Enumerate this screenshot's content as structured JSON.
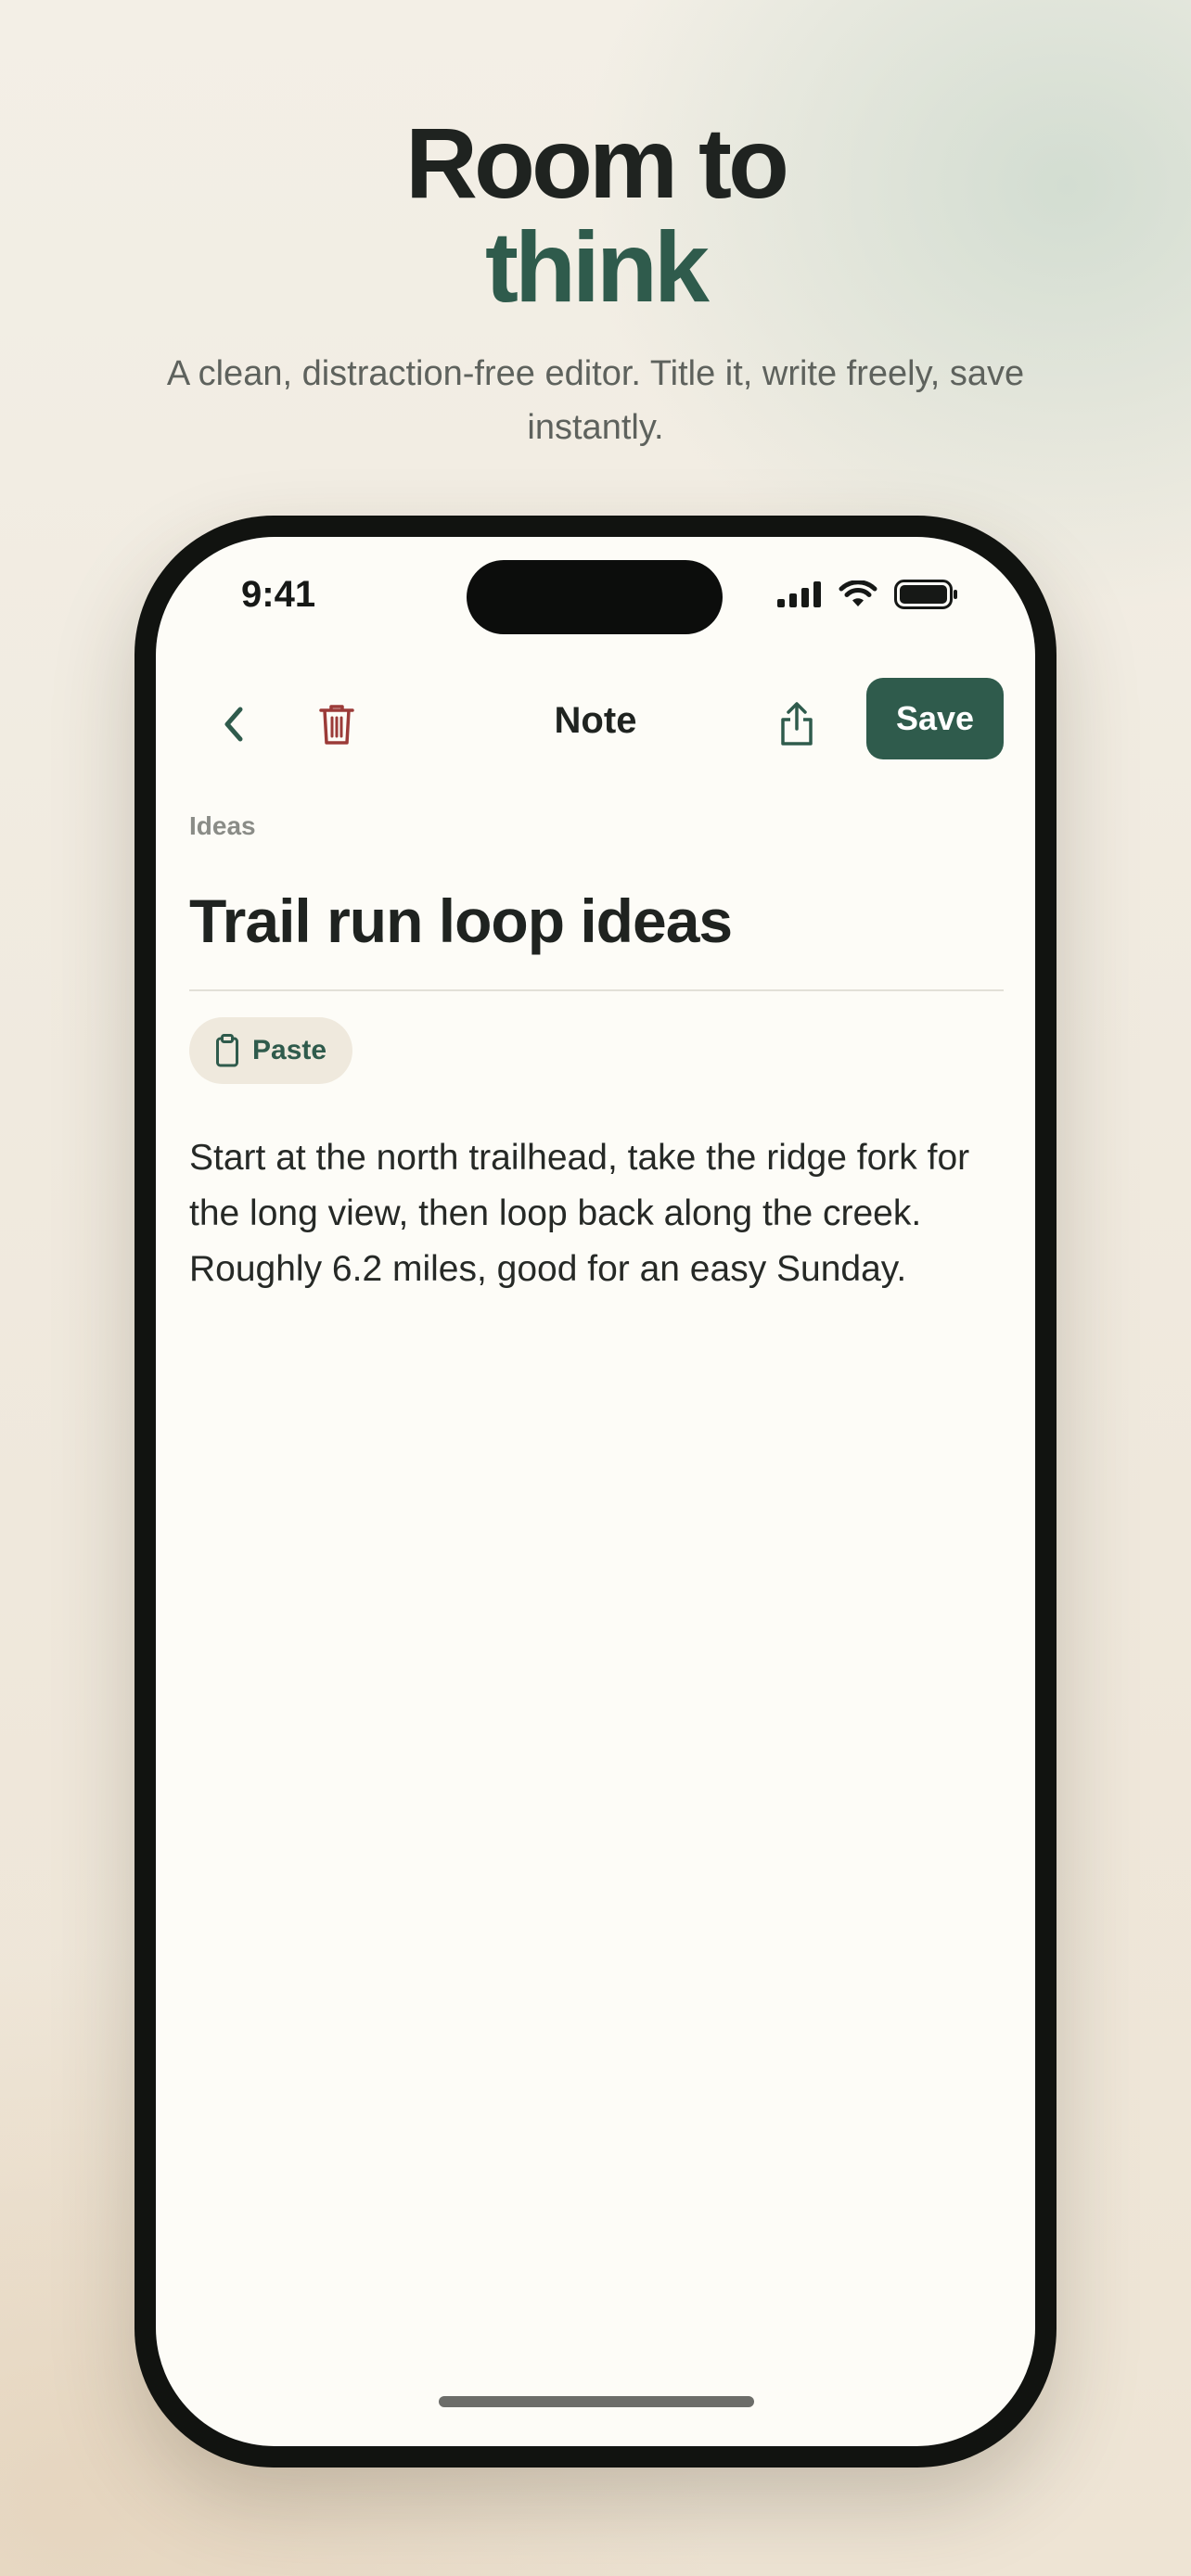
{
  "hero": {
    "line1": "Room to",
    "line2": "think",
    "subtitle": "A clean, distraction-free editor. Title it, write freely, save instantly."
  },
  "status_bar": {
    "time": "9:41",
    "icons": [
      "cellular-signal-icon",
      "wifi-icon",
      "battery-icon"
    ]
  },
  "nav": {
    "back_icon": "chevron-left-icon",
    "delete_icon": "trash-icon",
    "title": "Note",
    "share_icon": "share-icon",
    "save_label": "Save"
  },
  "note": {
    "category": "Ideas",
    "title": "Trail run loop ideas",
    "paste_label": "Paste",
    "paste_icon": "clipboard-icon",
    "body": "Start at the north trailhead, take the ridge fork for the long view, then loop back along the creek. Roughly 6.2 miles, good for an easy Sunday."
  },
  "colors": {
    "accent": "#2f5b4c",
    "danger": "#9b3b38",
    "text": "#1f2320",
    "muted": "#8a8c87",
    "screen_bg": "#fdfcf7",
    "chip_bg": "#efe9dd"
  }
}
